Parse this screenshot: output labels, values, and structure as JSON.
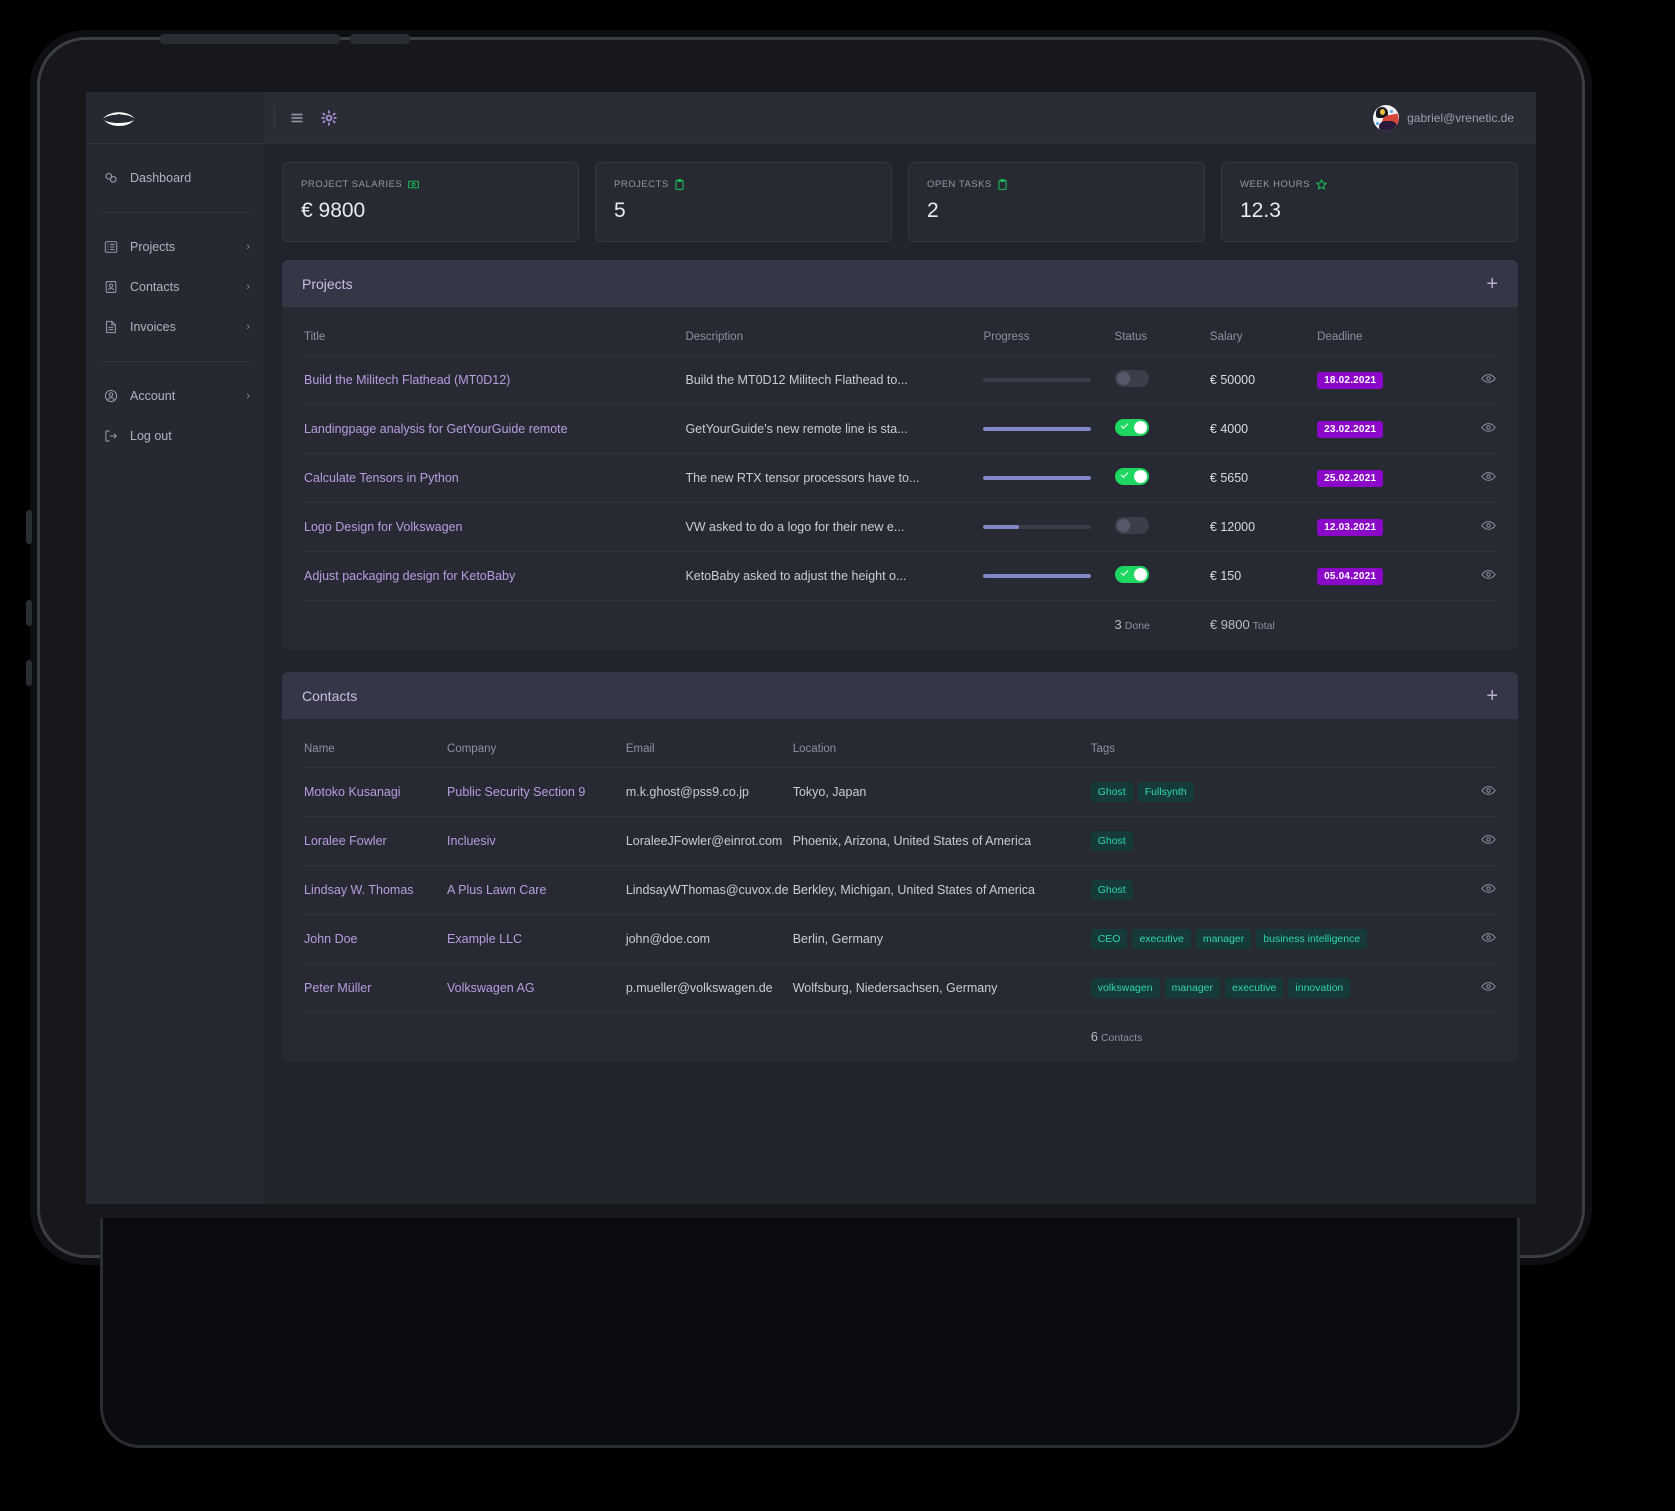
{
  "brand": {
    "logo_icon": "eye-logo"
  },
  "topbar": {
    "menu_icon": "hamburger-menu-icon",
    "settings_icon": "gear-icon",
    "user_email": "gabriel@vrenetic.de",
    "avatar_icon": "user-avatar"
  },
  "sidebar": {
    "primary": [
      {
        "label": "Dashboard",
        "icon": "dashboard-icon",
        "chevron": ""
      }
    ],
    "middle": [
      {
        "label": "Projects",
        "icon": "projects-icon",
        "chevron": "›"
      },
      {
        "label": "Contacts",
        "icon": "contacts-icon",
        "chevron": "›"
      },
      {
        "label": "Invoices",
        "icon": "invoices-icon",
        "chevron": "›"
      }
    ],
    "bottom": [
      {
        "label": "Account",
        "icon": "account-icon",
        "chevron": "›"
      },
      {
        "label": "Log out",
        "icon": "logout-icon",
        "chevron": ""
      }
    ]
  },
  "stats": [
    {
      "label": "PROJECT SALARIES",
      "icon": "money-icon",
      "value": "€ 9800"
    },
    {
      "label": "PROJECTS",
      "icon": "clipboard-icon",
      "value": "5"
    },
    {
      "label": "OPEN TASKS",
      "icon": "clipboard-icon",
      "value": "2"
    },
    {
      "label": "WEEK HOURS",
      "icon": "star-icon",
      "value": "12.3"
    }
  ],
  "projects_panel": {
    "title": "Projects",
    "add_label": "+",
    "columns": [
      "Title",
      "Description",
      "Progress",
      "Status",
      "Salary",
      "Deadline",
      ""
    ],
    "rows": [
      {
        "title": "Build the Militech Flathead (MT0D12)",
        "description": "Build the MT0D12 Militech Flathead to...",
        "progress": 0,
        "status": false,
        "salary": "€ 50000",
        "deadline": "18.02.2021"
      },
      {
        "title": "Landingpage analysis for GetYourGuide remote",
        "description": "GetYourGuide's new remote line is sta...",
        "progress": 100,
        "status": true,
        "salary": "€ 4000",
        "deadline": "23.02.2021"
      },
      {
        "title": "Calculate Tensors in Python",
        "description": "The new RTX tensor processors have to...",
        "progress": 100,
        "status": true,
        "salary": "€ 5650",
        "deadline": "25.02.2021"
      },
      {
        "title": "Logo Design for Volkswagen",
        "description": "VW asked to do a logo for their new e...",
        "progress": 33,
        "status": false,
        "salary": "€ 12000",
        "deadline": "12.03.2021"
      },
      {
        "title": "Adjust packaging design for KetoBaby",
        "description": "KetoBaby asked to adjust the height o...",
        "progress": 100,
        "status": true,
        "salary": "€ 150",
        "deadline": "05.04.2021"
      }
    ],
    "footer": {
      "done_count": "3",
      "done_label": "Done",
      "total_value": "€ 9800",
      "total_label": "Total"
    }
  },
  "contacts_panel": {
    "title": "Contacts",
    "add_label": "+",
    "columns": [
      "Name",
      "Company",
      "Email",
      "Location",
      "Tags",
      ""
    ],
    "rows": [
      {
        "name": "Motoko Kusanagi",
        "company": "Public Security Section 9",
        "email": "m.k.ghost@pss9.co.jp",
        "location": "Tokyo, Japan",
        "tags": [
          "Ghost",
          "Fullsynth"
        ]
      },
      {
        "name": "Loralee Fowler",
        "company": "Incluesiv",
        "email": "LoraleeJFowler@einrot.com",
        "location": "Phoenix, Arizona, United States of America",
        "tags": [
          "Ghost"
        ]
      },
      {
        "name": "Lindsay W. Thomas",
        "company": "A Plus Lawn Care",
        "email": "LindsayWThomas@cuvox.de",
        "location": "Berkley, Michigan, United States of America",
        "tags": [
          "Ghost"
        ]
      },
      {
        "name": "John Doe",
        "company": "Example LLC",
        "email": "john@doe.com",
        "location": "Berlin, Germany",
        "tags": [
          "CEO",
          "executive",
          "manager",
          "business intelligence"
        ]
      },
      {
        "name": "Peter Müller",
        "company": "Volkswagen AG",
        "email": "p.mueller@volkswagen.de",
        "location": "Wolfsburg, Niedersachsen, Germany",
        "tags": [
          "volkswagen",
          "manager",
          "executive",
          "innovation"
        ]
      }
    ],
    "footer": {
      "count": "6",
      "label": "Contacts"
    }
  },
  "colors": {
    "accent_purple": "#8c08c9",
    "link_purple": "#b99ce0",
    "toggle_green": "#1ed760",
    "tag_teal": "#2fd6b0",
    "progress_blue": "#8188c8",
    "panel_bg": "#272a33",
    "panel_head_bg": "#353746"
  }
}
